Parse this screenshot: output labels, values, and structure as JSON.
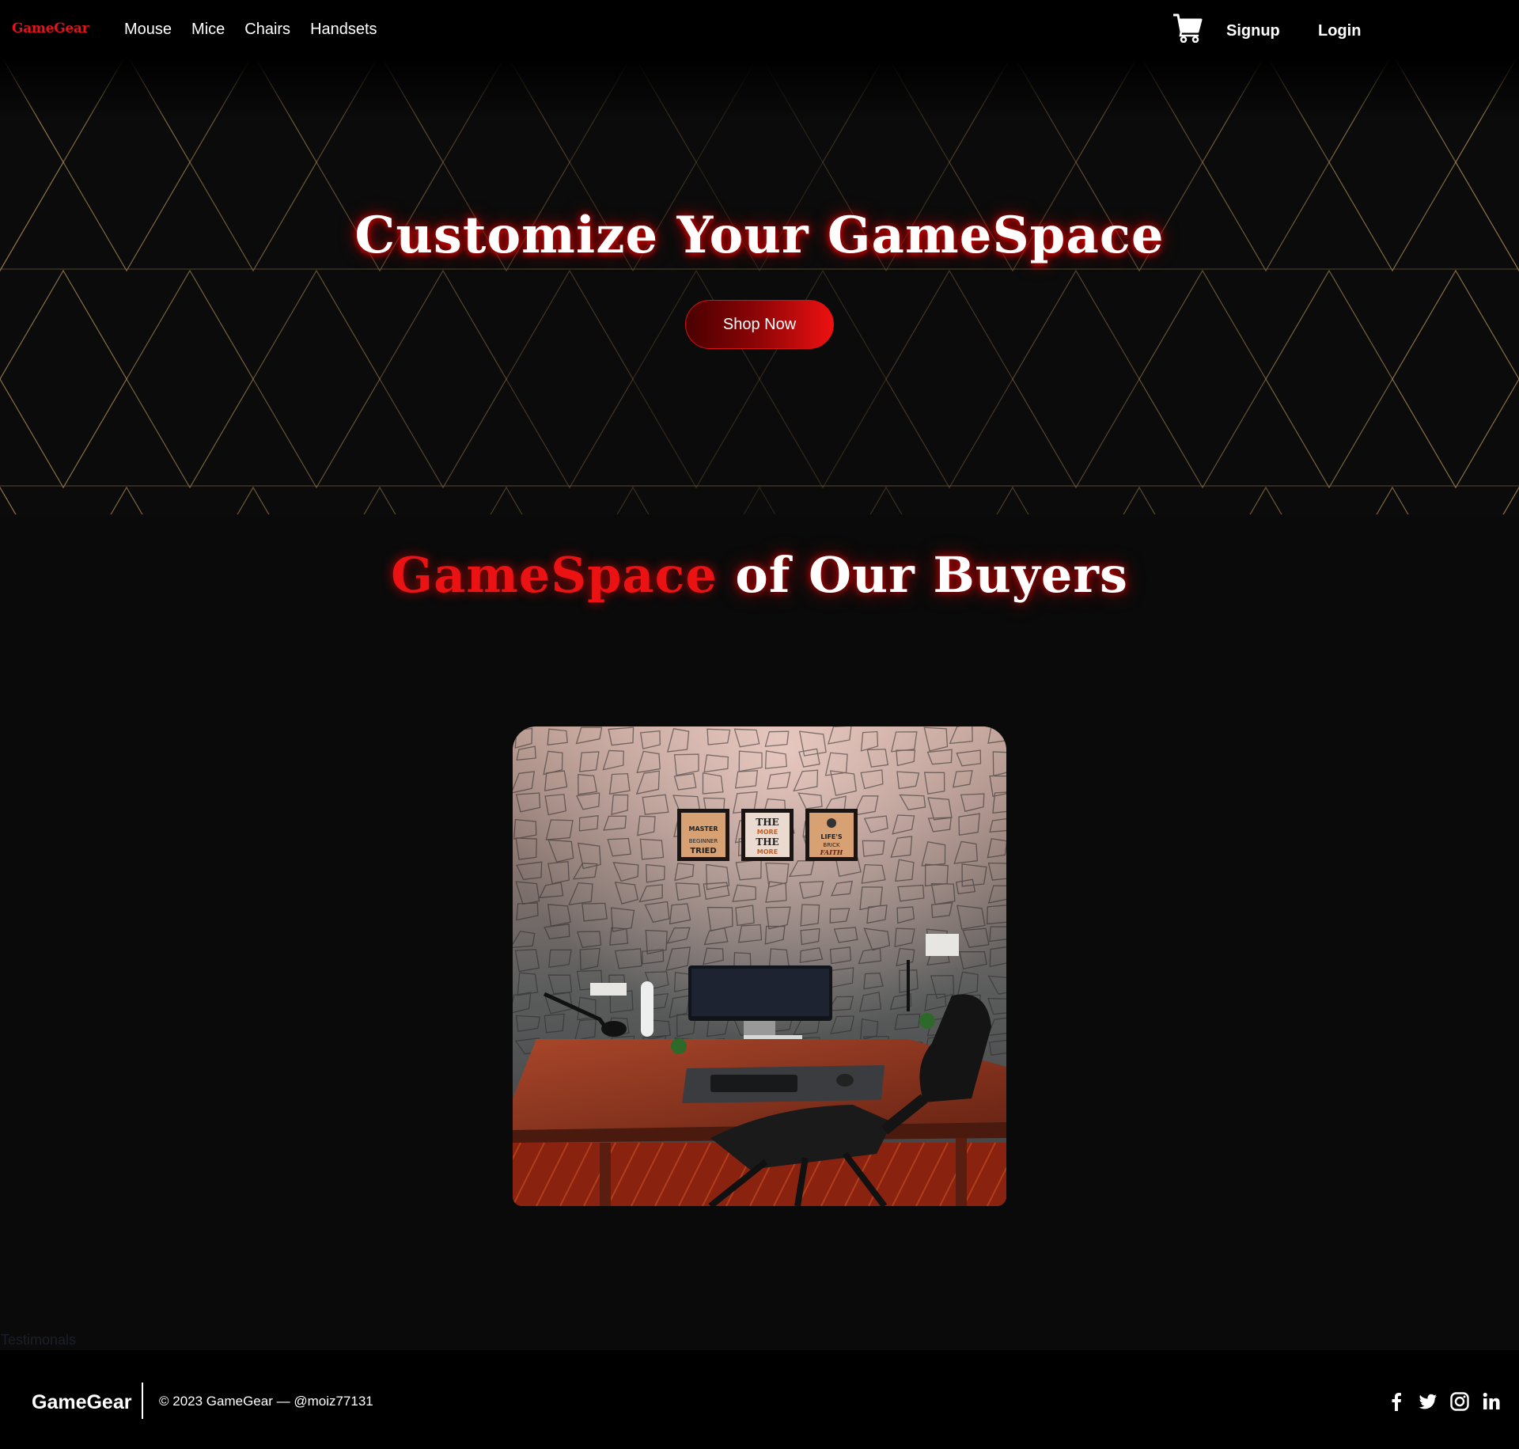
{
  "navbar": {
    "brand": "GameGear",
    "links": [
      {
        "label": "Mouse"
      },
      {
        "label": "Mice"
      },
      {
        "label": "Chairs"
      },
      {
        "label": "Handsets"
      }
    ],
    "cart_icon": "shopping-cart-icon",
    "signup_label": "Signup",
    "login_label": "Login"
  },
  "hero": {
    "title": "Customize Your GameSpace",
    "button_label": "Shop Now",
    "pattern_color": "#b8935a"
  },
  "buyers_section": {
    "title_highlight": "GameSpace",
    "title_rest": "of Our Buyers",
    "photo_posters": [
      "MASTER",
      "BEGINNER",
      "TRIED",
      "THE",
      "MORE",
      "THE",
      "MORE",
      "LIFE'S",
      "BRICK",
      "FAITH"
    ]
  },
  "testimonials_label": "Testimonals",
  "footer": {
    "brand": "GameGear",
    "copyright": "© 2023 GameGear — @moiz77131",
    "socials": [
      "facebook-icon",
      "twitter-icon",
      "instagram-icon",
      "linkedin-icon"
    ]
  },
  "colors": {
    "accent_red": "#ea1212",
    "background": "#0a0a0a",
    "navbar": "#000000"
  }
}
